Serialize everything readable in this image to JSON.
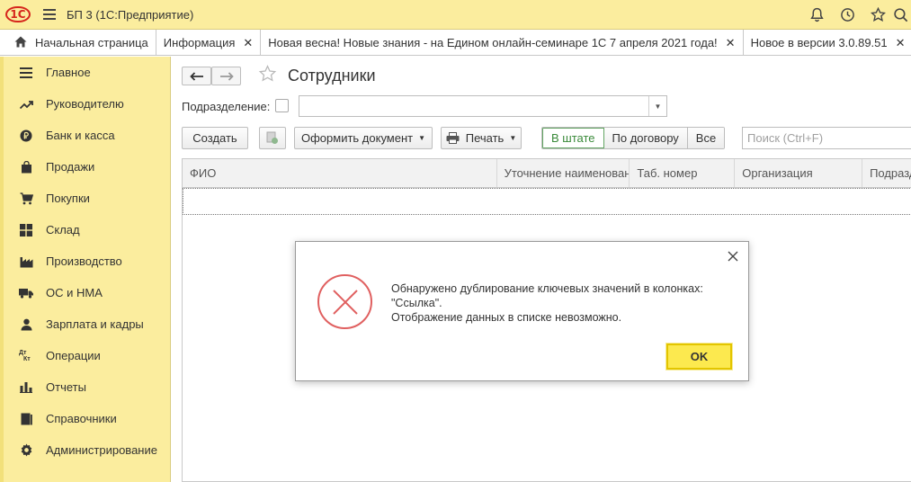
{
  "titlebar": {
    "logo": "1С",
    "title": "БП 3  (1С:Предприятие)",
    "icons": [
      "bell-icon",
      "history-icon",
      "star-icon",
      "search-icon"
    ]
  },
  "tabs": [
    {
      "label": "Начальная страница",
      "closable": false
    },
    {
      "label": "Информация",
      "closable": true
    },
    {
      "label": "Новая весна! Новые знания - на Едином онлайн-семинаре 1С 7 апреля 2021 года!",
      "closable": true
    },
    {
      "label": "Новое в версии 3.0.89.51",
      "closable": true
    }
  ],
  "sidebar": {
    "items": [
      {
        "label": "Главное",
        "icon": "menu-lines-icon"
      },
      {
        "label": "Руководителю",
        "icon": "trend-icon"
      },
      {
        "label": "Банк и касса",
        "icon": "ruble-icon"
      },
      {
        "label": "Продажи",
        "icon": "bag-icon"
      },
      {
        "label": "Покупки",
        "icon": "cart-icon"
      },
      {
        "label": "Склад",
        "icon": "warehouse-icon"
      },
      {
        "label": "Производство",
        "icon": "factory-icon"
      },
      {
        "label": "ОС и НМА",
        "icon": "truck-icon"
      },
      {
        "label": "Зарплата и кадры",
        "icon": "person-icon"
      },
      {
        "label": "Операции",
        "icon": "dt-kt-icon"
      },
      {
        "label": "Отчеты",
        "icon": "chart-icon"
      },
      {
        "label": "Справочники",
        "icon": "book-icon"
      },
      {
        "label": "Администрирование",
        "icon": "gear-icon"
      }
    ]
  },
  "main": {
    "title": "Сотрудники",
    "podr_label": "Подразделение:",
    "buttons": {
      "create": "Создать",
      "oformit": "Оформить документ",
      "print": "Печать"
    },
    "filter": [
      "В штате",
      "По договору",
      "Все"
    ],
    "search_placeholder": "Поиск (Ctrl+F)",
    "columns": [
      "ФИО",
      "Уточнение наименования",
      "Таб. номер",
      "Организация",
      "Подразделение"
    ]
  },
  "dialog": {
    "line1": "Обнаружено дублирование ключевых значений в колонках:",
    "line2": "\"Ссылка\".",
    "line3": "Отображение данных в списке невозможно.",
    "ok": "OK"
  }
}
